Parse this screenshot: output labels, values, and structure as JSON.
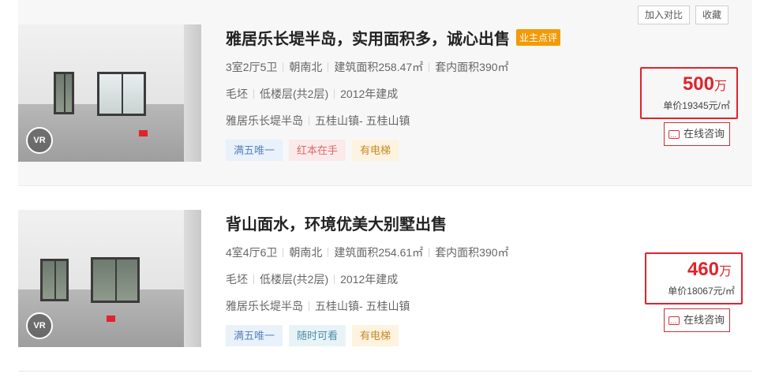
{
  "actions": {
    "compare_label": "加入对比",
    "favorite_label": "收藏"
  },
  "vr_label": "VR",
  "consult_label": "在线咨询",
  "listings": [
    {
      "title": "雅居乐长堤半岛，实用面积多，诚心出售",
      "owner_badge": "业主点评",
      "layout": "3室2厅5卫",
      "orientation": "朝南北",
      "build_area": "建筑面积258.47㎡",
      "inner_area": "套内面积390㎡",
      "decoration": "毛坯",
      "floor": "低楼层(共2层)",
      "year": "2012年建成",
      "community": "雅居乐长堤半岛",
      "district": "五桂山镇- 五桂山镇",
      "tags": [
        "满五唯一",
        "红本在手",
        "有电梯"
      ],
      "price": "500",
      "price_unit": "万",
      "unit_price": "单价19345元/㎡"
    },
    {
      "title": "背山面水，环境优美大别墅出售",
      "layout": "4室4厅6卫",
      "orientation": "朝南北",
      "build_area": "建筑面积254.61㎡",
      "inner_area": "套内面积390㎡",
      "decoration": "毛坯",
      "floor": "低楼层(共2层)",
      "year": "2012年建成",
      "community": "雅居乐长堤半岛",
      "district": "五桂山镇- 五桂山镇",
      "tags": [
        "满五唯一",
        "随时可看",
        "有电梯"
      ],
      "price": "460",
      "price_unit": "万",
      "unit_price": "单价18067元/㎡"
    }
  ]
}
